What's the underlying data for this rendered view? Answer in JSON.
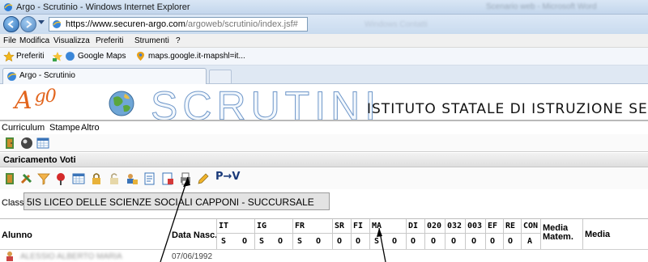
{
  "browser": {
    "window_title": "Argo - Scrutinio - Windows Internet Explorer",
    "title_right_blurred": "Scenario web - Microsoft Word",
    "url_host": "https://www.securen-argo.com",
    "url_path": "/argoweb/scrutinio/index.jsf#",
    "address_extra_blurred": "Windows    Contatti",
    "menu": [
      "File",
      "Modifica",
      "Visualizza",
      "Preferiti",
      "Strumenti",
      "?"
    ],
    "favorites": {
      "label": "Preferiti",
      "items": [
        "Google Maps",
        "maps.google.it-mapshl=it..."
      ]
    },
    "tab": "Argo - Scrutinio"
  },
  "app": {
    "logo": "Argo",
    "logo_prefix": "A",
    "header_title": "SCRUTINI",
    "school": "ISTITUTO STATALE DI ISTRUZIONE SECONDARIA",
    "menu": [
      "Curriculum",
      "Stampe",
      "Altro"
    ],
    "panel_title": "Caricamento Voti",
    "pv_button": "P→V",
    "class_label": "Classe:",
    "class_value": "5IS LICEO DELLE SCIENZE SOCIALI CAPPONI - SUCCURSALE"
  },
  "table": {
    "col_name": "Alunno",
    "col_birth": "Data Nasc.",
    "subjects": [
      {
        "code": "IT",
        "sub": [
          "S",
          "O"
        ]
      },
      {
        "code": "IG",
        "sub": [
          "S",
          "O"
        ]
      },
      {
        "code": "FR",
        "sub": [
          "S",
          "O"
        ]
      },
      {
        "code": "SR",
        "sub": [
          "O"
        ]
      },
      {
        "code": "FI",
        "sub": [
          "O"
        ]
      },
      {
        "code": "MA",
        "sub": [
          "S",
          "O"
        ]
      },
      {
        "code": "DI",
        "sub": [
          "O"
        ]
      },
      {
        "code": "020",
        "sub": [
          "O"
        ]
      },
      {
        "code": "032",
        "sub": [
          "O"
        ]
      },
      {
        "code": "003",
        "sub": [
          "O"
        ]
      },
      {
        "code": "EF",
        "sub": [
          "O"
        ]
      },
      {
        "code": "RE",
        "sub": [
          "O"
        ]
      },
      {
        "code": "CON",
        "sub": [
          "A"
        ]
      }
    ],
    "col_media_mat": "Media Matem.",
    "col_media": "Media",
    "rows": [
      {
        "name": "ALESSIO ALBERTO MARIA",
        "birth": "07/06/1992"
      }
    ]
  }
}
